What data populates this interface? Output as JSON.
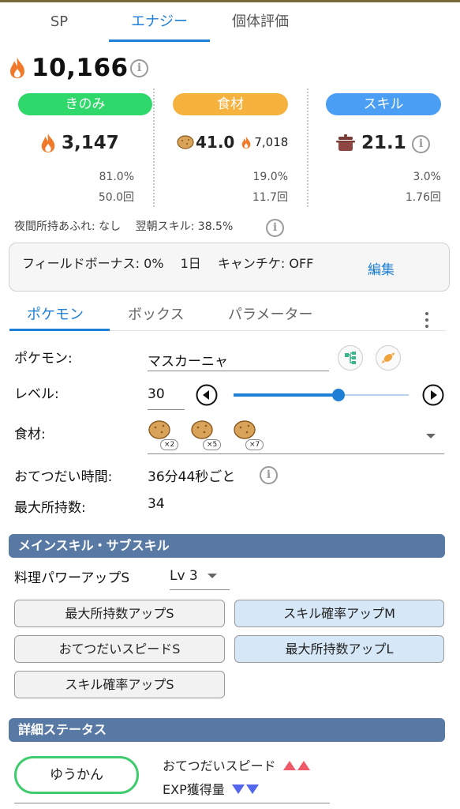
{
  "top_tabs": {
    "sp": "SP",
    "energy": "エナジー",
    "individual": "個体評価"
  },
  "total_energy": "10,166",
  "columns": {
    "berry": {
      "label": "きのみ",
      "value": "3,147",
      "pct": "81.0%",
      "count": "50.0回",
      "color": "#2fd86a"
    },
    "ingredient": {
      "label": "食材",
      "count_value": "41.0",
      "energy": "7,018",
      "pct": "19.0%",
      "count": "11.7回",
      "color": "#f5b23c"
    },
    "skill": {
      "label": "スキル",
      "value": "21.1",
      "pct": "3.0%",
      "count": "1.76回",
      "color": "#4a9ff5"
    }
  },
  "notes": {
    "night_overflow": "夜間所持あふれ: なし",
    "morning_skill": "翌朝スキル: 38.5%"
  },
  "bonus": {
    "text": "フィールドボーナス: 0%　 1日 　キャンチケ: OFF",
    "edit": "編集"
  },
  "sub_tabs": {
    "pokemon": "ポケモン",
    "box": "ボックス",
    "params": "パラメーター"
  },
  "form": {
    "pokemon_label": "ポケモン:",
    "pokemon_value": "マスカーニャ",
    "level_label": "レベル:",
    "level_value": "30",
    "level_fraction": 0.6,
    "ingredient_label": "食材:",
    "ingredient_counts": [
      "×2",
      "×5",
      "×7"
    ],
    "help_time_label": "おてつだい時間:",
    "help_time_value": "36分44秒ごと",
    "max_carry_label": "最大所持数:",
    "max_carry_value": "34"
  },
  "main_skill_section": "メインスキル・サブスキル",
  "main_skill": {
    "name": "料理パワーアップS",
    "level": "Lv 3"
  },
  "sub_skills": [
    "最大所持数アップS",
    "スキル確率アップM",
    "おてつだいスピードS",
    "最大所持数アップL",
    "スキル確率アップS"
  ],
  "detail_section": "詳細ステータス",
  "nature": {
    "name": "ゆうかん",
    "up": "おてつだいスピード",
    "down": "EXP獲得量"
  }
}
